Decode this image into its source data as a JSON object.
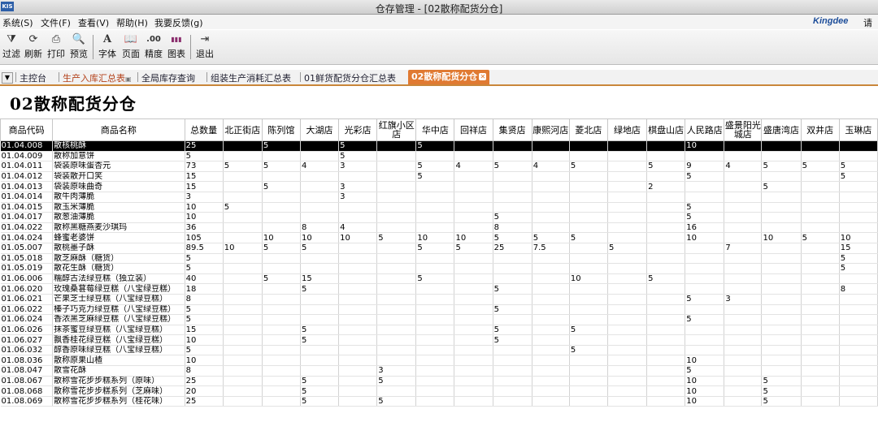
{
  "window": {
    "app_icon": "KIS",
    "title": "仓存管理 - [02散称配货分仓]"
  },
  "menu": {
    "items": [
      "系统(S)",
      "文件(F)",
      "查看(V)",
      "帮助(H)",
      "我要反馈(g)"
    ],
    "brand": "Kingdee",
    "brand_extra": "请"
  },
  "toolbar": {
    "buttons": [
      {
        "label": "过滤",
        "icon": "filter-icon",
        "glyph": "⧩"
      },
      {
        "label": "刷新",
        "icon": "refresh-icon",
        "glyph": "⟳"
      },
      {
        "label": "打印",
        "icon": "print-icon",
        "glyph": "⎙"
      },
      {
        "label": "预览",
        "icon": "preview-icon",
        "glyph": "🔍"
      },
      {
        "label": "字体",
        "icon": "font-icon",
        "glyph": "A"
      },
      {
        "label": "页面",
        "icon": "page-icon",
        "glyph": "📖"
      },
      {
        "label": "精度",
        "icon": "precision-icon",
        "glyph": ".00"
      },
      {
        "label": "图表",
        "icon": "chart-icon",
        "glyph": "▮▮▮"
      },
      {
        "label": "退出",
        "icon": "exit-icon",
        "glyph": "⇥"
      }
    ]
  },
  "tabs": [
    {
      "label": "主控台",
      "style": "normal"
    },
    {
      "label": "生产入库汇总表",
      "style": "red"
    },
    {
      "label": "全局库存查询",
      "style": "normal"
    },
    {
      "label": "组装生产消耗汇总表",
      "style": "normal"
    },
    {
      "label": "01鲜货配货分仓汇总表",
      "style": "normal"
    },
    {
      "label": "02散称配货分仓",
      "style": "active"
    }
  ],
  "page_title": "02散称配货分仓",
  "table": {
    "columns": [
      "商品代码",
      "商品名称",
      "总数量",
      "北正街店",
      "陈列馆",
      "大湖店",
      "光彩店",
      "红旗小区店",
      "华中店",
      "回祥店",
      "集贤店",
      "康熙河店",
      "菱北店",
      "绿地店",
      "棋盘山店",
      "人民路店",
      "盛景阳光城店",
      "盛唐湾店",
      "双井店",
      "玉琳店"
    ],
    "selected_row": 0,
    "rows": [
      [
        "01.04.008",
        "散核桃酥",
        "25",
        "",
        "5",
        "",
        "5",
        "",
        "5",
        "",
        "",
        "",
        "",
        "",
        "",
        "10",
        "",
        "",
        "",
        ""
      ],
      [
        "01.04.009",
        "散称加意饼",
        "5",
        "",
        "",
        "",
        "5",
        "",
        "",
        "",
        "",
        "",
        "",
        "",
        "",
        "",
        "",
        "",
        "",
        ""
      ],
      [
        "01.04.011",
        "袋装原味蛋杏元",
        "73",
        "5",
        "5",
        "4",
        "3",
        "",
        "5",
        "4",
        "5",
        "4",
        "5",
        "",
        "5",
        "9",
        "4",
        "5",
        "5",
        "5"
      ],
      [
        "01.04.012",
        "袋装散开口笑",
        "15",
        "",
        "",
        "",
        "",
        "",
        "5",
        "",
        "",
        "",
        "",
        "",
        "",
        "5",
        "",
        "",
        "",
        "5"
      ],
      [
        "01.04.013",
        "袋装原味曲奇",
        "15",
        "",
        "5",
        "",
        "3",
        "",
        "",
        "",
        "",
        "",
        "",
        "",
        "2",
        "",
        "",
        "5",
        "",
        ""
      ],
      [
        "01.04.014",
        "散牛肉薄脆",
        "3",
        "",
        "",
        "",
        "3",
        "",
        "",
        "",
        "",
        "",
        "",
        "",
        "",
        "",
        "",
        "",
        "",
        ""
      ],
      [
        "01.04.015",
        "散玉米薄脆",
        "10",
        "5",
        "",
        "",
        "",
        "",
        "",
        "",
        "",
        "",
        "",
        "",
        "",
        "5",
        "",
        "",
        "",
        ""
      ],
      [
        "01.04.017",
        "散葱油薄脆",
        "10",
        "",
        "",
        "",
        "",
        "",
        "",
        "",
        "5",
        "",
        "",
        "",
        "",
        "5",
        "",
        "",
        "",
        ""
      ],
      [
        "01.04.022",
        "散称黑糖燕麦沙琪玛",
        "36",
        "",
        "",
        "8",
        "4",
        "",
        "",
        "",
        "8",
        "",
        "",
        "",
        "",
        "16",
        "",
        "",
        "",
        ""
      ],
      [
        "01.04.024",
        "蜂蜜老婆饼",
        "105",
        "",
        "10",
        "10",
        "10",
        "5",
        "10",
        "10",
        "5",
        "5",
        "5",
        "",
        "",
        "10",
        "",
        "10",
        "5",
        "10"
      ],
      [
        "01.05.007",
        "散桃墨子酥",
        "89.5",
        "10",
        "5",
        "5",
        "",
        "",
        "5",
        "5",
        "25",
        "7.5",
        "",
        "5",
        "",
        "",
        "7",
        "",
        "",
        "15"
      ],
      [
        "01.05.018",
        "散芝麻酥（糖货）",
        "5",
        "",
        "",
        "",
        "",
        "",
        "",
        "",
        "",
        "",
        "",
        "",
        "",
        "",
        "",
        "",
        "",
        "5"
      ],
      [
        "01.05.019",
        "散花生酥（糖货）",
        "5",
        "",
        "",
        "",
        "",
        "",
        "",
        "",
        "",
        "",
        "",
        "",
        "",
        "",
        "",
        "",
        "",
        "5"
      ],
      [
        "01.06.006",
        "糯醇古法绿豆糕（独立装）",
        "40",
        "",
        "5",
        "15",
        "",
        "",
        "5",
        "",
        "",
        "",
        "10",
        "",
        "5",
        "",
        "",
        "",
        "",
        ""
      ],
      [
        "01.06.020",
        "玫瑰桑葚莓绿豆糕（八宝绿豆糕）",
        "18",
        "",
        "",
        "5",
        "",
        "",
        "",
        "",
        "5",
        "",
        "",
        "",
        "",
        "",
        "",
        "",
        "",
        "8"
      ],
      [
        "01.06.021",
        "芒果芝士绿豆糕（八宝绿豆糕）",
        "8",
        "",
        "",
        "",
        "",
        "",
        "",
        "",
        "",
        "",
        "",
        "",
        "",
        "5",
        "3",
        "",
        "",
        ""
      ],
      [
        "01.06.022",
        "榛子巧克力绿豆糕（八宝绿豆糕）",
        "5",
        "",
        "",
        "",
        "",
        "",
        "",
        "",
        "5",
        "",
        "",
        "",
        "",
        "",
        "",
        "",
        "",
        ""
      ],
      [
        "01.06.024",
        "香浓黑芝麻绿豆糕（八宝绿豆糕）",
        "5",
        "",
        "",
        "",
        "",
        "",
        "",
        "",
        "",
        "",
        "",
        "",
        "",
        "5",
        "",
        "",
        "",
        ""
      ],
      [
        "01.06.026",
        "抹茶蜜豆绿豆糕（八宝绿豆糕）",
        "15",
        "",
        "",
        "5",
        "",
        "",
        "",
        "",
        "5",
        "",
        "5",
        "",
        "",
        "",
        "",
        "",
        "",
        ""
      ],
      [
        "01.06.027",
        "飘香桂花绿豆糕（八宝绿豆糕）",
        "10",
        "",
        "",
        "5",
        "",
        "",
        "",
        "",
        "5",
        "",
        "",
        "",
        "",
        "",
        "",
        "",
        "",
        ""
      ],
      [
        "01.06.032",
        "醇香原味绿豆糕（八宝绿豆糕）",
        "5",
        "",
        "",
        "",
        "",
        "",
        "",
        "",
        "",
        "",
        "5",
        "",
        "",
        "",
        "",
        "",
        "",
        ""
      ],
      [
        "01.08.036",
        "散称原果山楂",
        "10",
        "",
        "",
        "",
        "",
        "",
        "",
        "",
        "",
        "",
        "",
        "",
        "",
        "10",
        "",
        "",
        "",
        ""
      ],
      [
        "01.08.047",
        "散雪花酥",
        "8",
        "",
        "",
        "",
        "",
        "3",
        "",
        "",
        "",
        "",
        "",
        "",
        "",
        "5",
        "",
        "",
        "",
        ""
      ],
      [
        "01.08.067",
        "散称雪花步步糕系列（原味）",
        "25",
        "",
        "",
        "5",
        "",
        "5",
        "",
        "",
        "",
        "",
        "",
        "",
        "",
        "10",
        "",
        "5",
        "",
        ""
      ],
      [
        "01.08.068",
        "散称雪花步步糕系列（芝麻味）",
        "20",
        "",
        "",
        "5",
        "",
        "",
        "",
        "",
        "",
        "",
        "",
        "",
        "",
        "10",
        "",
        "5",
        "",
        ""
      ],
      [
        "01.08.069",
        "散称雪花步步糕系列（桂花味）",
        "25",
        "",
        "",
        "5",
        "",
        "5",
        "",
        "",
        "",
        "",
        "",
        "",
        "",
        "10",
        "",
        "5",
        "",
        ""
      ]
    ]
  }
}
